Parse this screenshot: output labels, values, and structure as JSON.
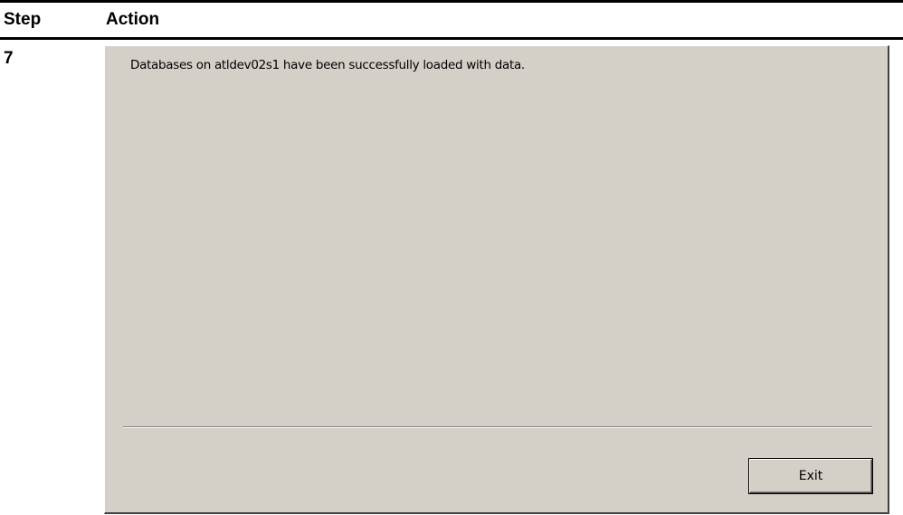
{
  "table": {
    "header": {
      "step": "Step",
      "action": "Action"
    },
    "row": {
      "step": "7"
    }
  },
  "dialog": {
    "message": "Databases on atldev02s1 have been successfully loaded with data.",
    "exit_label": "Exit",
    "background": "#d4d0c8"
  }
}
